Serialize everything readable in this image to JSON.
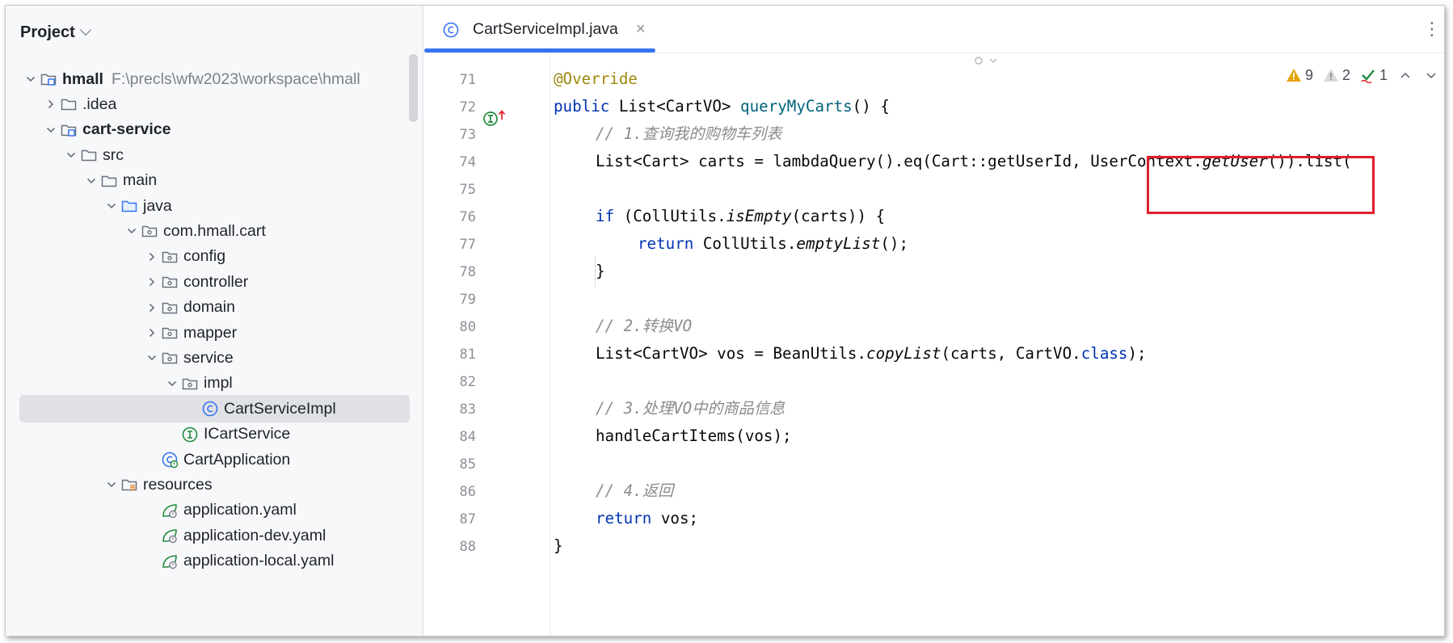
{
  "project": {
    "title": "Project",
    "tree": [
      {
        "label": "hmall",
        "path": "F:\\precls\\wfw2023\\workspace\\hmall",
        "bold": true,
        "icon": "module-icon",
        "expanded": true
      },
      {
        "label": ".idea",
        "icon": "folder-icon",
        "expanded": false
      },
      {
        "label": "cart-service",
        "bold": true,
        "icon": "module-icon",
        "expanded": true
      },
      {
        "label": "src",
        "icon": "folder-icon",
        "expanded": true
      },
      {
        "label": "main",
        "icon": "folder-icon",
        "expanded": true
      },
      {
        "label": "java",
        "icon": "source-folder-icon",
        "expanded": true
      },
      {
        "label": "com.hmall.cart",
        "icon": "package-icon",
        "expanded": true
      },
      {
        "label": "config",
        "icon": "package-icon",
        "expanded": false
      },
      {
        "label": "controller",
        "icon": "package-icon",
        "expanded": false
      },
      {
        "label": "domain",
        "icon": "package-icon",
        "expanded": false
      },
      {
        "label": "mapper",
        "icon": "package-icon",
        "expanded": false
      },
      {
        "label": "service",
        "icon": "package-icon",
        "expanded": true
      },
      {
        "label": "impl",
        "icon": "package-icon",
        "expanded": true
      },
      {
        "label": "CartServiceImpl",
        "icon": "class-icon",
        "selected": true
      },
      {
        "label": "ICartService",
        "icon": "interface-icon"
      },
      {
        "label": "CartApplication",
        "icon": "spring-class-icon"
      },
      {
        "label": "resources",
        "icon": "resources-folder-icon",
        "expanded": true
      },
      {
        "label": "application.yaml",
        "icon": "spring-yaml-icon"
      },
      {
        "label": "application-dev.yaml",
        "icon": "spring-yaml-icon"
      },
      {
        "label": "application-local.yaml",
        "icon": "spring-yaml-icon"
      }
    ]
  },
  "editor": {
    "tab_label": "CartServiceImpl.java",
    "tab_close": "×",
    "menu_glyph": "⋮",
    "inspections": {
      "errors": "9",
      "warnings": "2",
      "typos": "1"
    },
    "line_numbers": [
      "71",
      "72",
      "73",
      "74",
      "75",
      "76",
      "77",
      "78",
      "79",
      "80",
      "81",
      "82",
      "83",
      "84",
      "85",
      "86",
      "87",
      "88"
    ],
    "code": {
      "l71_annotation": "@Override",
      "l72_public": "public",
      "l72_type": " List<CartVO> ",
      "l72_method": "queryMyCarts",
      "l72_rest": "() {",
      "l73_comment": "// 1.查询我的购物车列表",
      "l74_a": "List<Cart> carts = lambdaQuery().eq(Cart::getUserId, UserContext.",
      "l74_b": "getUser",
      "l74_c": "()).list(",
      "l76_if": "if",
      "l76_a": " (CollUtils.",
      "l76_b": "isEmpty",
      "l76_c": "(carts)) {",
      "l77_return": "return",
      "l77_a": " CollUtils.",
      "l77_b": "emptyList",
      "l77_c": "();",
      "l78": "}",
      "l80_comment": "// 2.转换VO",
      "l81_a": "List<CartVO> vos = BeanUtils.",
      "l81_b": "copyList",
      "l81_c": "(carts, CartVO.",
      "l81_kw": "class",
      "l81_d": ");",
      "l83_comment": "// 3.处理VO中的商品信息",
      "l84": "handleCartItems(vos);",
      "l86_comment": "// 4.返回",
      "l87_return": "return",
      "l87_a": " vos;",
      "l88": "}"
    }
  },
  "colors": {
    "keyword": "#0033b3",
    "annotation": "#9e880d",
    "method_decl": "#00627a",
    "comment": "#8c8c8c",
    "highlight_box": "#e01e2b",
    "tab_underline": "#3574f0"
  }
}
